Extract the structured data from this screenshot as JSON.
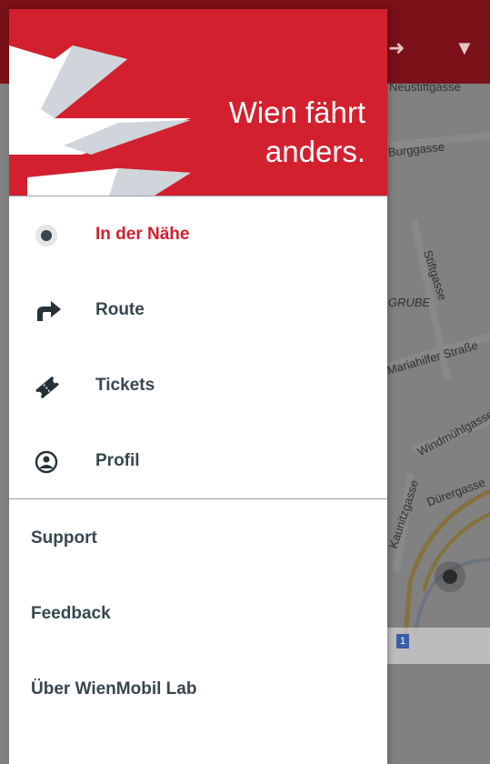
{
  "app": {
    "slogan_line1": "Wien fährt",
    "slogan_line2": "anders."
  },
  "colors": {
    "brand_red": "#d2202f",
    "text_dark": "#37474f"
  },
  "nav": {
    "items": [
      {
        "label": "In der Nähe",
        "icon": "location-dot-icon",
        "active": true
      },
      {
        "label": "Route",
        "icon": "route-arrow-icon",
        "active": false
      },
      {
        "label": "Tickets",
        "icon": "ticket-icon",
        "active": false
      },
      {
        "label": "Profil",
        "icon": "profile-icon",
        "active": false
      }
    ]
  },
  "secondary": {
    "items": [
      {
        "label": "Support"
      },
      {
        "label": "Feedback"
      },
      {
        "label": "Über WienMobil Lab"
      }
    ]
  },
  "map": {
    "street_neustiftgasse": "Neustiftgasse",
    "street_burggasse": "Burggasse",
    "street_stiftgasse": "Stiftgasse",
    "area_grube": "GRUBE",
    "street_mariahilfer": "Mariahilfer Straße",
    "street_windmuehlgasse": "Windmühlgasse",
    "street_duerergasse": "Dürergasse",
    "street_kaunitzgasse": "Kaunitzgasse",
    "line_badge": "1"
  }
}
